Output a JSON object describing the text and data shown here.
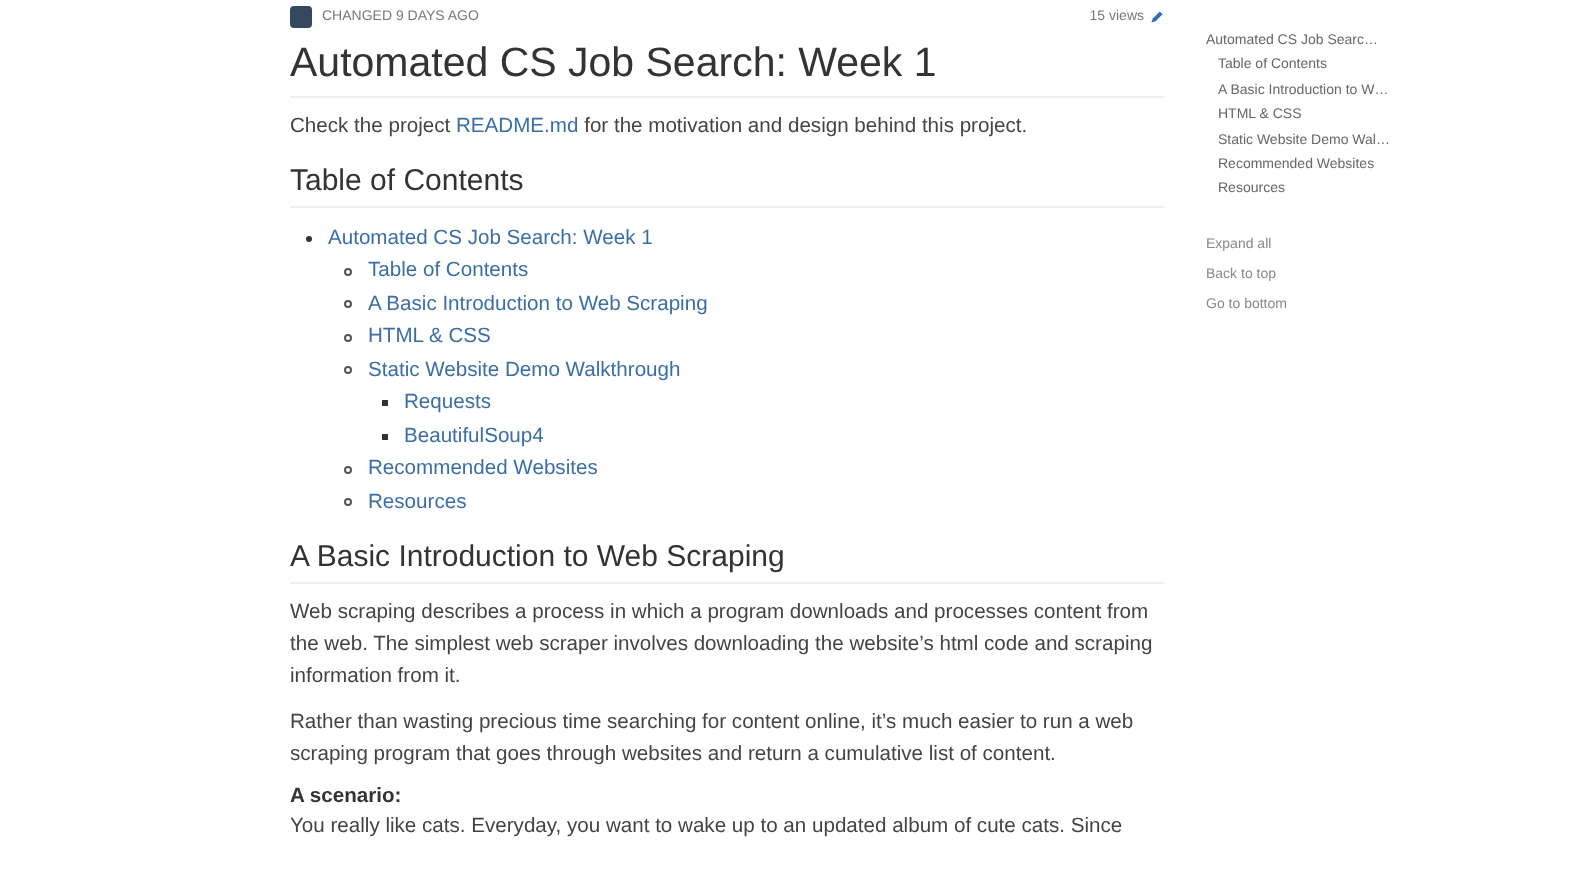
{
  "meta": {
    "changed": "CHANGED 9 DAYS AGO",
    "views": "15 views"
  },
  "title": "Automated CS Job Search: Week 1",
  "intro": {
    "before": "Check the project ",
    "link": "README.md",
    "after": " for the motivation and design behind this project."
  },
  "toc_heading": "Table of Contents",
  "toc": [
    {
      "label": "Automated CS Job Search: Week 1",
      "children": [
        {
          "label": "Table of Contents"
        },
        {
          "label": "A Basic Introduction to Web Scraping"
        },
        {
          "label": "HTML & CSS"
        },
        {
          "label": "Static Website Demo Walkthrough",
          "children": [
            {
              "label": "Requests"
            },
            {
              "label": "BeautifulSoup4"
            }
          ]
        },
        {
          "label": "Recommended Websites"
        },
        {
          "label": "Resources"
        }
      ]
    }
  ],
  "section_heading": "A Basic Introduction to Web Scraping",
  "paragraphs": [
    {
      "kind": "text",
      "text": "Web scraping describes a process in which a program downloads and processes content from the web. The simplest web scraper involves downloading the website’s html code and scraping information from it."
    },
    {
      "kind": "text",
      "text": "Rather than wasting precious time searching for content online, it’s much easier to run a web scraping program that goes through websites and return a cumulative list of content."
    },
    {
      "kind": "subheading",
      "text": "A scenario:"
    },
    {
      "kind": "line",
      "text": "You really like cats. Everyday, you want to wake up to an updated album of cute cats. Since"
    }
  ],
  "sidebar": {
    "toc": [
      {
        "label": "Automated CS Job Searc…",
        "children": [
          {
            "label": "Table of Contents"
          },
          {
            "label": "A Basic Introduction to W…"
          },
          {
            "label": "HTML & CSS"
          },
          {
            "label": "Static Website Demo Wal…"
          },
          {
            "label": "Recommended Websites"
          },
          {
            "label": "Resources"
          }
        ]
      }
    ],
    "actions": [
      "Expand all",
      "Back to top",
      "Go to bottom"
    ]
  }
}
